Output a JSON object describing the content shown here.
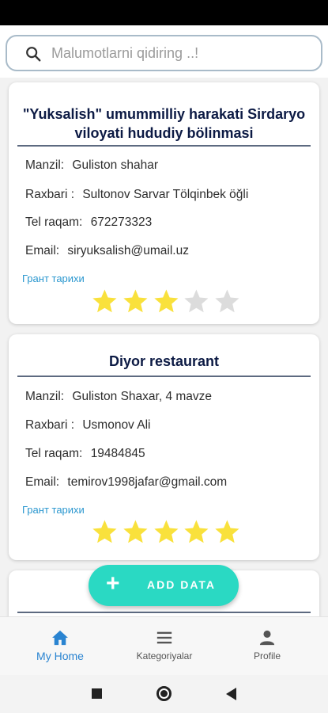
{
  "search": {
    "placeholder": "Malumotlarni qidiring ..!"
  },
  "cards": [
    {
      "title": "\"Yuksalish\" umummilliy harakati Sirdaryo viloyati hududiy bölinmasi",
      "address_label": "Manzil:",
      "address": "Guliston shahar",
      "leader_label": "Raxbari :",
      "leader": "Sultonov Sarvar Tölqinbek öğli",
      "phone_label": "Tel raqam:",
      "phone": "672273323",
      "email_label": "Email:",
      "email": "siryuksalish@umail.uz",
      "grant_link": "Грант тарихи",
      "rating": 3,
      "rating_max": 5
    },
    {
      "title": "Diyor restaurant",
      "address_label": "Manzil:",
      "address": "Guliston Shaxar, 4 mavze",
      "leader_label": "Raxbari :",
      "leader": "Usmonov Ali",
      "phone_label": "Tel raqam:",
      "phone": "19484845",
      "email_label": "Email:",
      "email": "temirov1998jafar@gmail.com",
      "grant_link": "Грант тарихи",
      "rating": 5,
      "rating_max": 5
    }
  ],
  "fab": {
    "label": "ADD DATA"
  },
  "nav": {
    "home": "My Home",
    "categories": "Kategoriyalar",
    "profile": "Profile"
  },
  "colors": {
    "star_filled": "#f9e13c",
    "star_empty": "#dcdcdc",
    "accent": "#2ad9c3",
    "active_nav": "#2a84d1"
  }
}
